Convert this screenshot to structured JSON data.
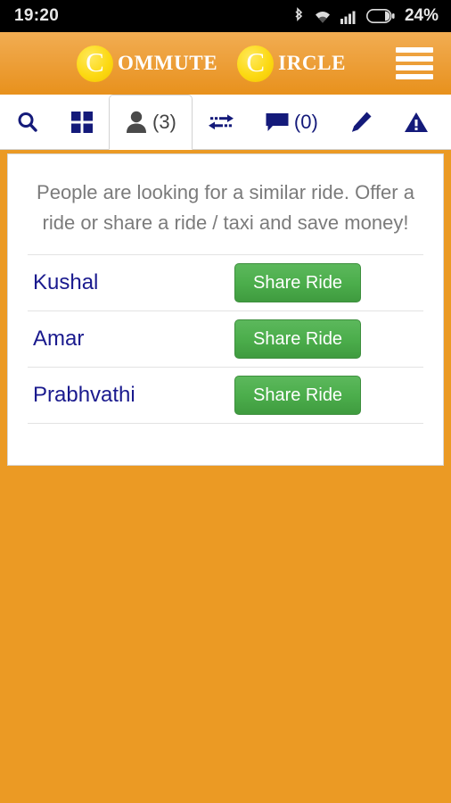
{
  "status_bar": {
    "time": "19:20",
    "battery_percent": "24%",
    "icons": [
      "bluetooth-icon",
      "wifi-icon",
      "cellular-signal-icon",
      "battery-icon"
    ]
  },
  "app_bar": {
    "brand": [
      {
        "badge": "C",
        "rest": "OMMUTE"
      },
      {
        "badge": "C",
        "rest": "IRCLE"
      }
    ],
    "menu_icon": "hamburger-menu-icon",
    "background_color": "#eb9a24",
    "badge_color": "#fcd913"
  },
  "tabs": [
    {
      "icon": "search-icon",
      "label": "",
      "active": false
    },
    {
      "icon": "grid-icon",
      "label": "",
      "active": false
    },
    {
      "icon": "person-icon",
      "label": "(3)",
      "active": true
    },
    {
      "icon": "exchange-icon",
      "label": "",
      "active": false
    },
    {
      "icon": "comment-icon",
      "label": "(0)",
      "active": false
    },
    {
      "icon": "pencil-icon",
      "label": "",
      "active": false
    },
    {
      "icon": "warning-icon",
      "label": "",
      "active": false
    }
  ],
  "content": {
    "notice": "People are looking for a similar ride. Offer a ride or share a ride / taxi and save money!",
    "rows": [
      {
        "name": "Kushal",
        "action_label": "Share Ride"
      },
      {
        "name": "Amar",
        "action_label": "Share Ride"
      },
      {
        "name": "Prabhvathi",
        "action_label": "Share Ride"
      }
    ],
    "link_color": "#1a1a8e",
    "button_color": "#4cae4c"
  }
}
